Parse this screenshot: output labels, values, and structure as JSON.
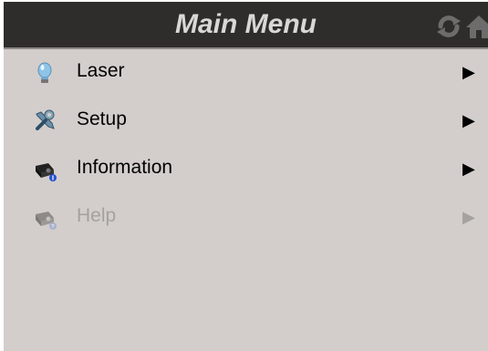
{
  "header": {
    "title": "Main Menu",
    "refresh_icon": "refresh-icon",
    "home_icon": "home-icon",
    "background_color": "#2f2d2c",
    "title_color": "#d9d7d7"
  },
  "menu": {
    "items": [
      {
        "label": "Laser",
        "icon": "lightbulb-icon",
        "arrow": "▶",
        "enabled": true
      },
      {
        "label": "Setup",
        "icon": "tools-icon",
        "arrow": "▶",
        "enabled": true
      },
      {
        "label": "Information",
        "icon": "projector-info-icon",
        "arrow": "▶",
        "enabled": true
      },
      {
        "label": "Help",
        "icon": "projector-help-icon",
        "arrow": "▶",
        "enabled": false
      }
    ],
    "background_color": "#d3cecb",
    "disabled_color": "#a5a19f"
  }
}
